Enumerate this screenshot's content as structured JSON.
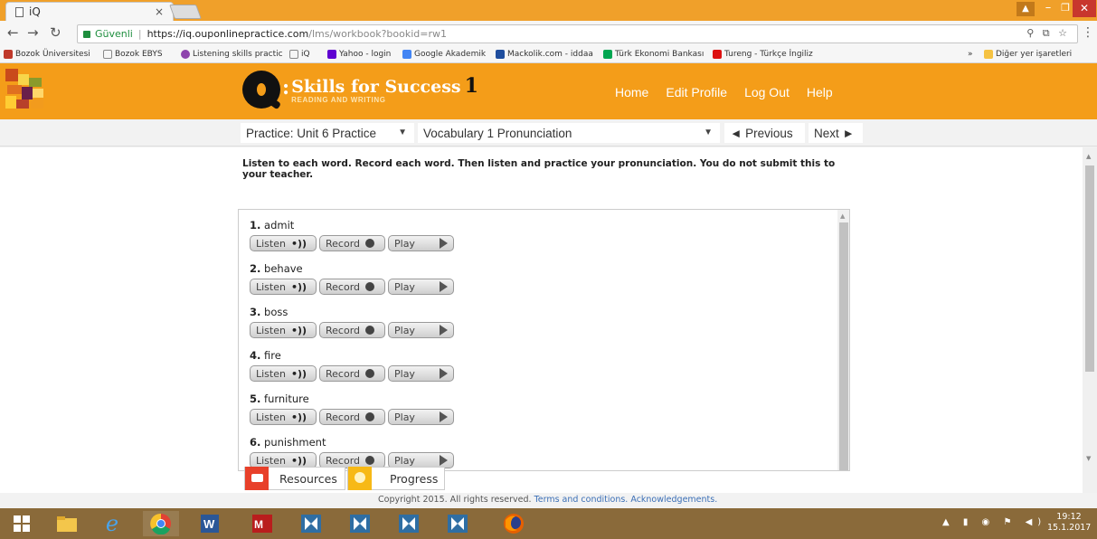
{
  "browser": {
    "tab_title": "iQ",
    "tab_close": "×",
    "secure_label": "Güvenli",
    "url_host": "https://iq.ouponlinepractice.com",
    "url_path": "/lms/workbook?bookid=rw1",
    "bookmarks": [
      {
        "label": "Bozok Üniversitesi",
        "color": "#c0392b"
      },
      {
        "label": "Bozok EBYS",
        "color": "#888888"
      },
      {
        "label": "Listening skills practic",
        "color": "#8e44ad"
      },
      {
        "label": "iQ",
        "color": "#888888"
      },
      {
        "label": "Yahoo - login",
        "color": "#5f01d1"
      },
      {
        "label": "Google Akademik",
        "color": "#4285f4"
      },
      {
        "label": "Mackolik.com - iddaa",
        "color": "#1f4e9e"
      },
      {
        "label": "Türk Ekonomi Bankası",
        "color": "#00a651"
      },
      {
        "label": "Tureng - Türkçe İngiliz",
        "color": "#d11"
      }
    ],
    "bookmarks_more": "»",
    "other_bookmarks": "Diğer yer işaretleri"
  },
  "header": {
    "brand_colon": ":",
    "brand_title": "Skills for Success",
    "brand_level": "1",
    "brand_sub": "READING AND WRITING",
    "nav": [
      "Home",
      "Edit Profile",
      "Log Out",
      "Help"
    ],
    "colors": {
      "orange": "#f49d19"
    }
  },
  "practice": {
    "unit_select": "Practice: Unit 6 Practice",
    "activity_select": "Vocabulary 1 Pronunciation",
    "previous": "◄ Previous",
    "next": "Next ►"
  },
  "instructions": "Listen to each word. Record each word. Then listen and practice your pronunciation. You do not submit this to your teacher.",
  "buttons": {
    "listen": "Listen",
    "record": "Record",
    "play": "Play",
    "listen_sym": "•))"
  },
  "words": [
    {
      "num": "1.",
      "word": "admit"
    },
    {
      "num": "2.",
      "word": "behave"
    },
    {
      "num": "3.",
      "word": "boss"
    },
    {
      "num": "4.",
      "word": "fire"
    },
    {
      "num": "5.",
      "word": "furniture"
    },
    {
      "num": "6.",
      "word": "punishment"
    }
  ],
  "bottom_tabs": {
    "resources": "Resources",
    "progress": "Progress"
  },
  "footer": {
    "copyright": "Copyright 2015. All rights reserved.",
    "terms": "Terms and conditions.",
    "ack": "Acknowledgements."
  },
  "taskbar": {
    "time": "19:12",
    "date": "15.1.2017"
  }
}
